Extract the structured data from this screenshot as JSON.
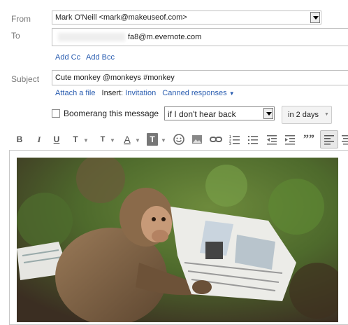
{
  "from": {
    "label": "From",
    "value": "Mark O'Neill <mark@makeuseof.com>"
  },
  "to": {
    "label": "To",
    "value": "fa8@m.evernote.com",
    "add_cc": "Add Cc",
    "add_bcc": "Add Bcc"
  },
  "subject": {
    "label": "Subject",
    "value": "Cute monkey @monkeys #monkey"
  },
  "attach": {
    "attach_file": "Attach a file",
    "insert_label": "Insert:",
    "invitation": "Invitation",
    "canned": "Canned responses"
  },
  "boomerang": {
    "label": "Boomerang this message",
    "condition": "if I don't hear back",
    "duration": "in 2 days"
  },
  "toolbar": {
    "bold": "B",
    "italic": "I",
    "underline": "U",
    "font": "T",
    "size": "T",
    "color": "A",
    "bg": "T",
    "quote": "””"
  }
}
